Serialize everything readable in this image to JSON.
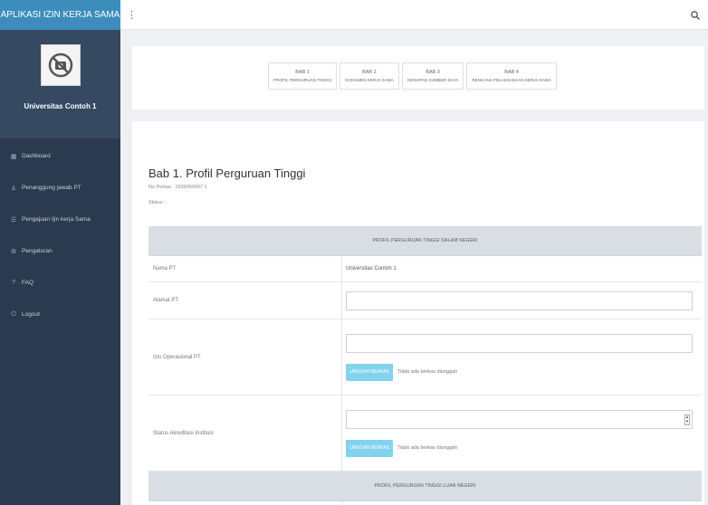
{
  "app": {
    "title": "APLIKASI IZIN KERJA SAMA"
  },
  "user": {
    "name": "Universitas Contoh 1",
    "avatar_icon": "no-photo-icon"
  },
  "sidebar": {
    "items": [
      {
        "label": "Dashboard",
        "icon": "dashboard-icon"
      },
      {
        "label": "Penanggung jawab PT",
        "icon": "user-icon"
      },
      {
        "label": "Pengajuan Ijin kerja Sama",
        "icon": "list-icon"
      },
      {
        "label": "Pengaturan",
        "icon": "gear-icon"
      },
      {
        "label": "FAQ",
        "icon": "question-icon"
      },
      {
        "label": "Logout",
        "icon": "logout-icon"
      }
    ]
  },
  "topbar": {
    "menu_icon": "menu-toggle-icon",
    "search_icon": "search-icon"
  },
  "steps": [
    {
      "number": "BAB 1",
      "label": "PROFIL PERGURUAN TINGGI"
    },
    {
      "number": "BAB 2",
      "label": "DOKUMEN KERJA SAMA"
    },
    {
      "number": "BAB 3",
      "label": "KESIAPAN SUMBER DAYA"
    },
    {
      "number": "BAB 4",
      "label": "RENCANA PELAKSANAAN KERJA SAMA"
    }
  ],
  "section": {
    "title": "Bab 1. Profil Perguruan Tinggi",
    "nomor": "No Pertaa : 1509090007 1",
    "status_label": "Status :"
  },
  "table": {
    "header_dalam": "PROFIL PERGURUAN TINGGI DALAM NEGERI",
    "header_luar": "PROFIL PERGURUAN TINGGI LUAR NEGERI",
    "rows": {
      "nama": {
        "label": "Nama PT",
        "value": "Universitas Contoh 1"
      },
      "alamat": {
        "label": "Alamat PT",
        "value": ""
      },
      "izin": {
        "label": "Izin Operasional PT",
        "value": ""
      },
      "akreditasi": {
        "label": "Status Akreditasi Institusi",
        "value": ""
      }
    },
    "upload_button": "UNGGAH BERKAS",
    "upload_info": "Tidak ada berkas diunggah"
  },
  "colors": {
    "sidebar": "#2b3a4f",
    "brand": "#3c8dbc",
    "upload_button": "#83d3ee"
  }
}
